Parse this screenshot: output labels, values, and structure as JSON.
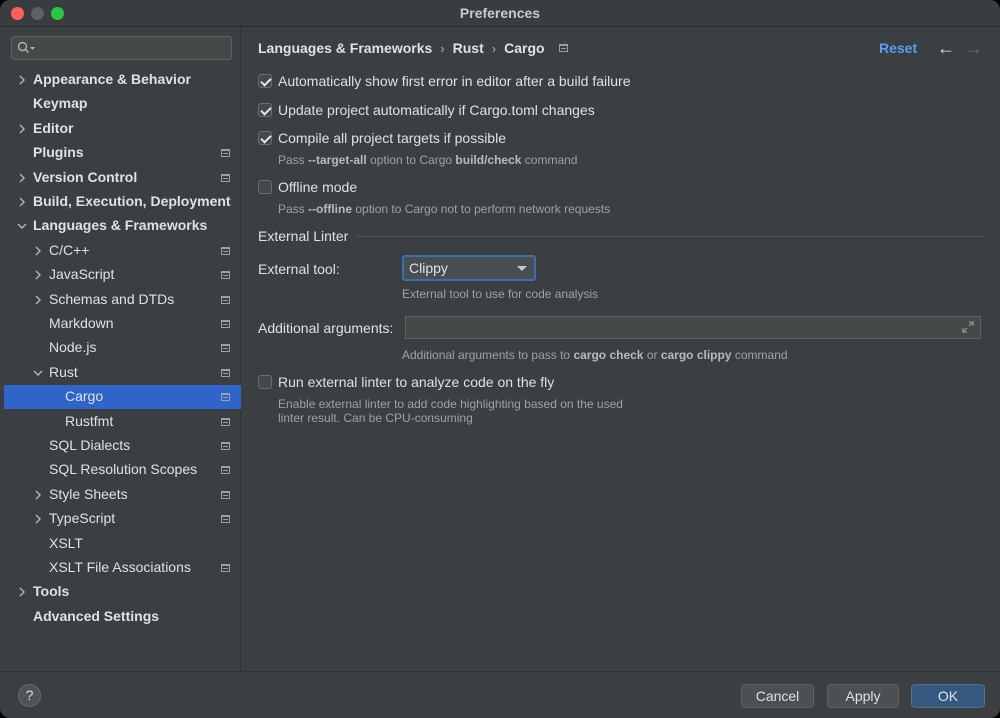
{
  "window": {
    "title": "Preferences"
  },
  "sidebar": {
    "search_placeholder": "",
    "items": [
      {
        "label": "Appearance & Behavior",
        "level": 0,
        "bold": true,
        "expandable": true,
        "expanded": false,
        "project": false
      },
      {
        "label": "Keymap",
        "level": 0,
        "bold": true,
        "expandable": false,
        "project": false
      },
      {
        "label": "Editor",
        "level": 0,
        "bold": true,
        "expandable": true,
        "expanded": false,
        "project": false
      },
      {
        "label": "Plugins",
        "level": 0,
        "bold": true,
        "expandable": false,
        "project": true
      },
      {
        "label": "Version Control",
        "level": 0,
        "bold": true,
        "expandable": true,
        "expanded": false,
        "project": true
      },
      {
        "label": "Build, Execution, Deployment",
        "level": 0,
        "bold": true,
        "expandable": true,
        "expanded": false,
        "project": false
      },
      {
        "label": "Languages & Frameworks",
        "level": 0,
        "bold": true,
        "expandable": true,
        "expanded": true,
        "project": false
      },
      {
        "label": "C/C++",
        "level": 1,
        "bold": false,
        "expandable": true,
        "expanded": false,
        "project": true
      },
      {
        "label": "JavaScript",
        "level": 1,
        "bold": false,
        "expandable": true,
        "expanded": false,
        "project": true
      },
      {
        "label": "Schemas and DTDs",
        "level": 1,
        "bold": false,
        "expandable": true,
        "expanded": false,
        "project": true
      },
      {
        "label": "Markdown",
        "level": 1,
        "bold": false,
        "expandable": false,
        "project": true
      },
      {
        "label": "Node.js",
        "level": 1,
        "bold": false,
        "expandable": false,
        "project": true
      },
      {
        "label": "Rust",
        "level": 1,
        "bold": false,
        "expandable": true,
        "expanded": true,
        "project": true
      },
      {
        "label": "Cargo",
        "level": 2,
        "bold": false,
        "expandable": false,
        "project": true,
        "selected": true
      },
      {
        "label": "Rustfmt",
        "level": 2,
        "bold": false,
        "expandable": false,
        "project": true
      },
      {
        "label": "SQL Dialects",
        "level": 1,
        "bold": false,
        "expandable": false,
        "project": true
      },
      {
        "label": "SQL Resolution Scopes",
        "level": 1,
        "bold": false,
        "expandable": false,
        "project": true
      },
      {
        "label": "Style Sheets",
        "level": 1,
        "bold": false,
        "expandable": true,
        "expanded": false,
        "project": true
      },
      {
        "label": "TypeScript",
        "level": 1,
        "bold": false,
        "expandable": true,
        "expanded": false,
        "project": true
      },
      {
        "label": "XSLT",
        "level": 1,
        "bold": false,
        "expandable": false,
        "project": false
      },
      {
        "label": "XSLT File Associations",
        "level": 1,
        "bold": false,
        "expandable": false,
        "project": true
      },
      {
        "label": "Tools",
        "level": 0,
        "bold": true,
        "expandable": true,
        "expanded": false,
        "project": false
      },
      {
        "label": "Advanced Settings",
        "level": 0,
        "bold": true,
        "expandable": false,
        "project": false
      }
    ]
  },
  "breadcrumb": {
    "items": [
      "Languages & Frameworks",
      "Rust",
      "Cargo"
    ]
  },
  "header": {
    "reset_label": "Reset",
    "back_icon": "←",
    "forward_icon": "→"
  },
  "settings": {
    "auto_show_error": {
      "label": "Automatically show first error in editor after a build failure",
      "checked": true
    },
    "update_project": {
      "label": "Update project automatically if Cargo.toml changes",
      "checked": true
    },
    "compile_all": {
      "label": "Compile all project targets if possible",
      "checked": true,
      "hint_pre": "Pass ",
      "hint_flag": "--target-all",
      "hint_mid": " option to Cargo ",
      "hint_cmd": "build/check",
      "hint_post": " command"
    },
    "offline_mode": {
      "label": "Offline mode",
      "checked": false,
      "hint_pre": "Pass ",
      "hint_flag": "--offline",
      "hint_post": " option to Cargo not to perform network requests"
    }
  },
  "external_linter": {
    "section_title": "External Linter",
    "tool_label": "External tool:",
    "tool_value": "Clippy",
    "tool_hint": "External tool to use for code analysis",
    "args_label": "Additional arguments:",
    "args_value": "",
    "args_hint_pre": "Additional arguments to pass to ",
    "args_hint_cmd1": "cargo check",
    "args_hint_mid": " or ",
    "args_hint_cmd2": "cargo clippy",
    "args_hint_post": " command",
    "run_on_fly": {
      "label": "Run external linter to analyze code on the fly",
      "checked": false
    },
    "run_hint_line1": "Enable external linter to add code highlighting based on the used",
    "run_hint_line2": "linter result. Can be CPU-consuming"
  },
  "footer": {
    "help_label": "?",
    "cancel_label": "Cancel",
    "apply_label": "Apply",
    "ok_label": "OK"
  },
  "colors": {
    "accent": "#2f65ca",
    "link": "#589df6",
    "background": "#3c3f41"
  }
}
